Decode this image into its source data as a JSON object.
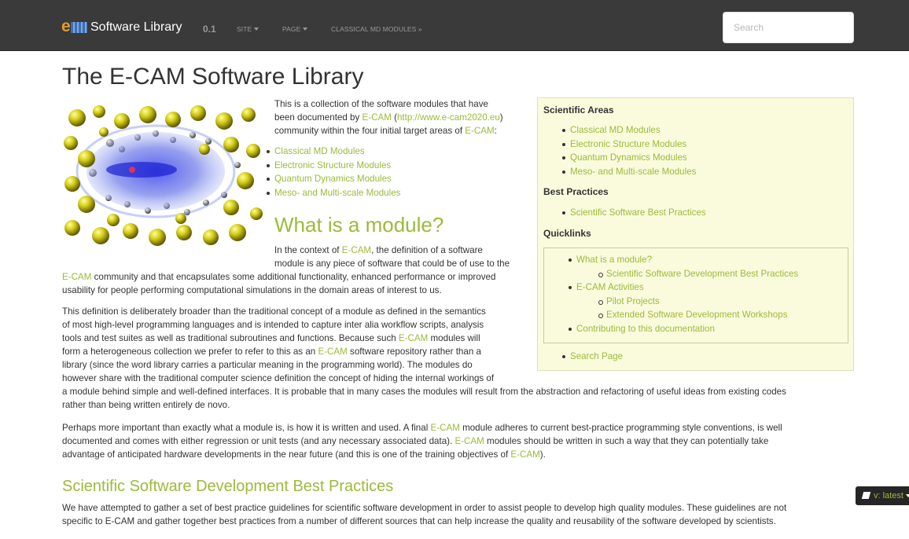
{
  "navbar": {
    "brand": "Software Library",
    "version": "0.1",
    "menu": [
      "SITE",
      "PAGE",
      "CLASSICAL MD MODULES »"
    ],
    "search_placeholder": "Search"
  },
  "main": {
    "title": "The E-CAM Software Library",
    "intro_lines": [
      [
        "This is a collection of the software modules that have"
      ],
      [
        "been documented by ",
        {
          "link": "E-CAM"
        },
        " (",
        {
          "link": "http://www.e-cam2020.eu"
        },
        ")"
      ],
      [
        "community within the four initial target areas of ",
        {
          "link": "E-CAM"
        },
        ":"
      ]
    ],
    "areas": [
      "Classical MD Modules",
      "Electronic Structure Modules",
      "Quantum Dynamics Modules",
      "Meso- and Multi-scale Modules"
    ],
    "module_heading": "What is a module?",
    "module_lines": [
      [
        "In the context of ",
        {
          "link": "E-CAM"
        },
        ", the definition of a software"
      ],
      [
        "module is any piece of software that could be of use to the"
      ],
      [
        {
          "link": "E-CAM"
        },
        " community and that encapsulates some additional functionality, enhanced performance or improved"
      ],
      [
        "usability for people performing computational simulations in the domain areas of interest to us."
      ]
    ],
    "definition_lines": [
      [
        "This definition is deliberately broader than the traditional concept of a module as defined in the semantics"
      ],
      [
        "of most high-level programming languages and is intended to capture inter alia workflow scripts, analysis"
      ],
      [
        "tools and test suites as well as traditional subroutines and functions. Because such ",
        {
          "link": "E-CAM"
        },
        " modules will"
      ],
      [
        "form a heterogeneous collection we prefer to refer to this as an ",
        {
          "link": "E-CAM"
        },
        " software repository rather than a"
      ],
      [
        "library (since the word library carries a particular meaning in the programming world). The modules do"
      ],
      [
        "however share with the traditional computer science definition the concept of hiding the internal workings of"
      ],
      [
        "a module behind simple and well-defined interfaces. It is probable that in many cases the modules will result from the abstraction and refactoring of useful ideas from existing codes"
      ],
      [
        "rather than being written entirely de novo."
      ]
    ],
    "important_lines": [
      [
        "Perhaps more important than exactly what a module is, is how it is written and used. A final ",
        {
          "link": "E-CAM"
        },
        " module adheres to current best-practice programming style conventions, is well"
      ],
      [
        "documented and comes with either regression or unit tests (and any necessary associated data). ",
        {
          "link": "E-CAM"
        },
        " modules should be written in such a way that they can potentially take"
      ],
      [
        "advantage of anticipated hardware developments in the near future (and this is one of the training objectives of ",
        {
          "link": "E-CAM"
        },
        ")."
      ]
    ],
    "best_heading": "Scientific Software Development Best Practices",
    "best_lines": [
      [
        "We have attempted to gather a set of best practice guidelines for scientific software development in order to assist people to develop high quality modules. These guidelines are not"
      ],
      [
        "specific to E-CAM and gather together best practices from a number of different sources that can help increase the quality and reusability of the software developed by scientists."
      ]
    ]
  },
  "sidebar": {
    "areas_heading": "Scientific Areas",
    "areas": [
      "Classical MD Modules",
      "Electronic Structure Modules",
      "Quantum Dynamics Modules",
      "Meso- and Multi-scale Modules"
    ],
    "best_heading": "Best Practices",
    "best": [
      "Scientific Software Best Practices"
    ],
    "quick_heading": "Quicklinks",
    "quicklinks": [
      {
        "label": "What is a module?",
        "level": 1
      },
      {
        "label": "Scientific Software Development Best Practices",
        "level": 2
      },
      {
        "label": "E-CAM Activities",
        "level": 1
      },
      {
        "label": "Pilot Projects",
        "level": 2
      },
      {
        "label": "Extended Software Development Workshops",
        "level": 2
      },
      {
        "label": "Contributing to this documentation",
        "level": 1
      }
    ],
    "search_page": "Search Page"
  },
  "version_badge": "v: latest",
  "colors": {
    "navbar": "#3a3a3a",
    "link": "#9cba3a",
    "sidebar_bg": "#fafbdd",
    "text": "#333333"
  }
}
